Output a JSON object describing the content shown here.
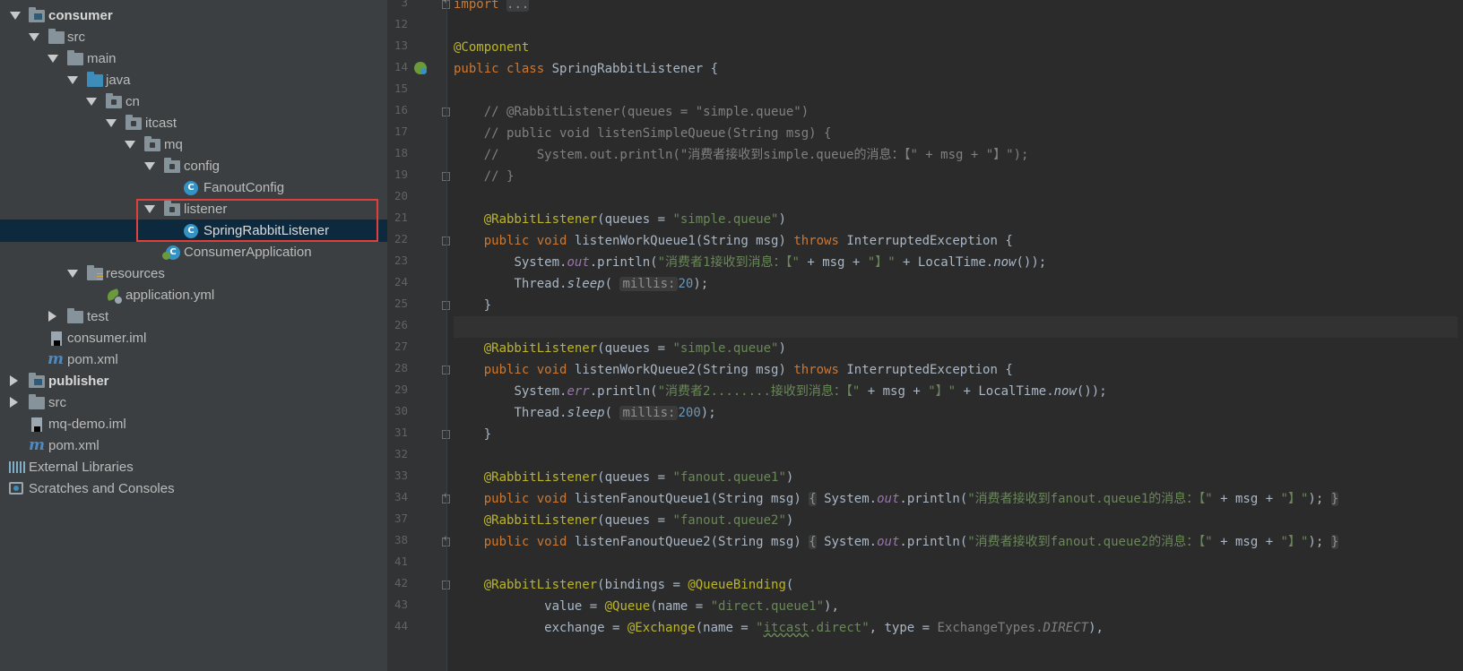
{
  "project_tree": {
    "nodes": [
      {
        "label": "consumer",
        "bold": true
      },
      {
        "label": "src"
      },
      {
        "label": "main"
      },
      {
        "label": "java"
      },
      {
        "label": "cn"
      },
      {
        "label": "itcast"
      },
      {
        "label": "mq"
      },
      {
        "label": "config"
      },
      {
        "label": "FanoutConfig"
      },
      {
        "label": "listener"
      },
      {
        "label": "SpringRabbitListener",
        "selected": true
      },
      {
        "label": "ConsumerApplication"
      },
      {
        "label": "resources"
      },
      {
        "label": "application.yml"
      },
      {
        "label": "test"
      },
      {
        "label": "consumer.iml"
      },
      {
        "label": "pom.xml"
      },
      {
        "label": "publisher",
        "bold": true
      },
      {
        "label": "src"
      },
      {
        "label": "mq-demo.iml"
      },
      {
        "label": "pom.xml"
      },
      {
        "label": "External Libraries"
      },
      {
        "label": "Scratches and Consoles"
      }
    ],
    "class_badge": "C"
  },
  "editor": {
    "line_numbers": [
      "3",
      "12",
      "13",
      "14",
      "15",
      "16",
      "17",
      "18",
      "19",
      "20",
      "21",
      "22",
      "23",
      "24",
      "25",
      "26",
      "27",
      "28",
      "29",
      "30",
      "31",
      "32",
      "33",
      "34",
      "37",
      "38",
      "41",
      "42",
      "43",
      "44"
    ],
    "t": {
      "import": "import",
      "import_fold": "...",
      "component": "@Component",
      "public": "public",
      "class": "class",
      "class_name": "SpringRabbitListener {",
      "c16": "// @RabbitListener(queues = \"simple.queue\")",
      "c17": "// public void listenSimpleQueue(String msg) {",
      "c18": "//     System.out.println(\"消费者接收到simple.queue的消息：【\" + msg + \"】\");",
      "c19": "// }",
      "rl": "@RabbitListener",
      "queues_eq": "(queues = ",
      "simple_queue": "\"simple.queue\"",
      "close_paren": ")",
      "void": "void",
      "m1_sig": "listenWorkQueue1(String msg) ",
      "throws": "throws",
      "exc": "InterruptedException {",
      "system": "System.",
      "out": "out",
      "err": "err",
      "println": ".println(",
      "s23": "\"消费者1接收到消息：【\"",
      "msg_concat": " + msg + ",
      "close_bracket": "\"】\"",
      "localtime": " + LocalTime.",
      "now": "now",
      "end_call": "());",
      "thread": "Thread.",
      "sleep": "sleep",
      "open_paren": "(",
      "millis_hint": "millis:",
      "v20": "20",
      "v200": "200",
      "end_stmt": ");",
      "brace_close": "}",
      "m2_sig": "listenWorkQueue2(String msg) ",
      "s29": "\"消费者2........接收到消息：【\"",
      "fanout_queue1": "\"fanout.queue1\"",
      "fanout_queue2": "\"fanout.queue2\"",
      "m3_sig": "listenFanoutQueue1(String msg)",
      "m4_sig": "listenFanoutQueue2(String msg)",
      "fold_open": "{",
      "s34": "\"消费者接收到fanout.queue1的消息：【\"",
      "s38": "\"消费者接收到fanout.queue2的消息：【\"",
      "fold_close": "}",
      "bindings": "(bindings = ",
      "qb": "@QueueBinding",
      "value_eq": "value = ",
      "queue_ann": "@Queue",
      "name_eq": "(name = ",
      "direct_queue1": "\"direct.queue1\"",
      "close_comma": "),",
      "exchange_eq": "exchange = ",
      "exchange_ann": "@Exchange",
      "itcast": "itcast",
      "direct_rest": ".direct\"",
      "quote_open": "\"",
      "comma_sp": ", ",
      "type_eq": "type = ",
      "et": "ExchangeTypes.",
      "direct_const": "DIRECT",
      "paren_space": "( ",
      "space_brace": " ",
      "semi_sp": " "
    }
  }
}
